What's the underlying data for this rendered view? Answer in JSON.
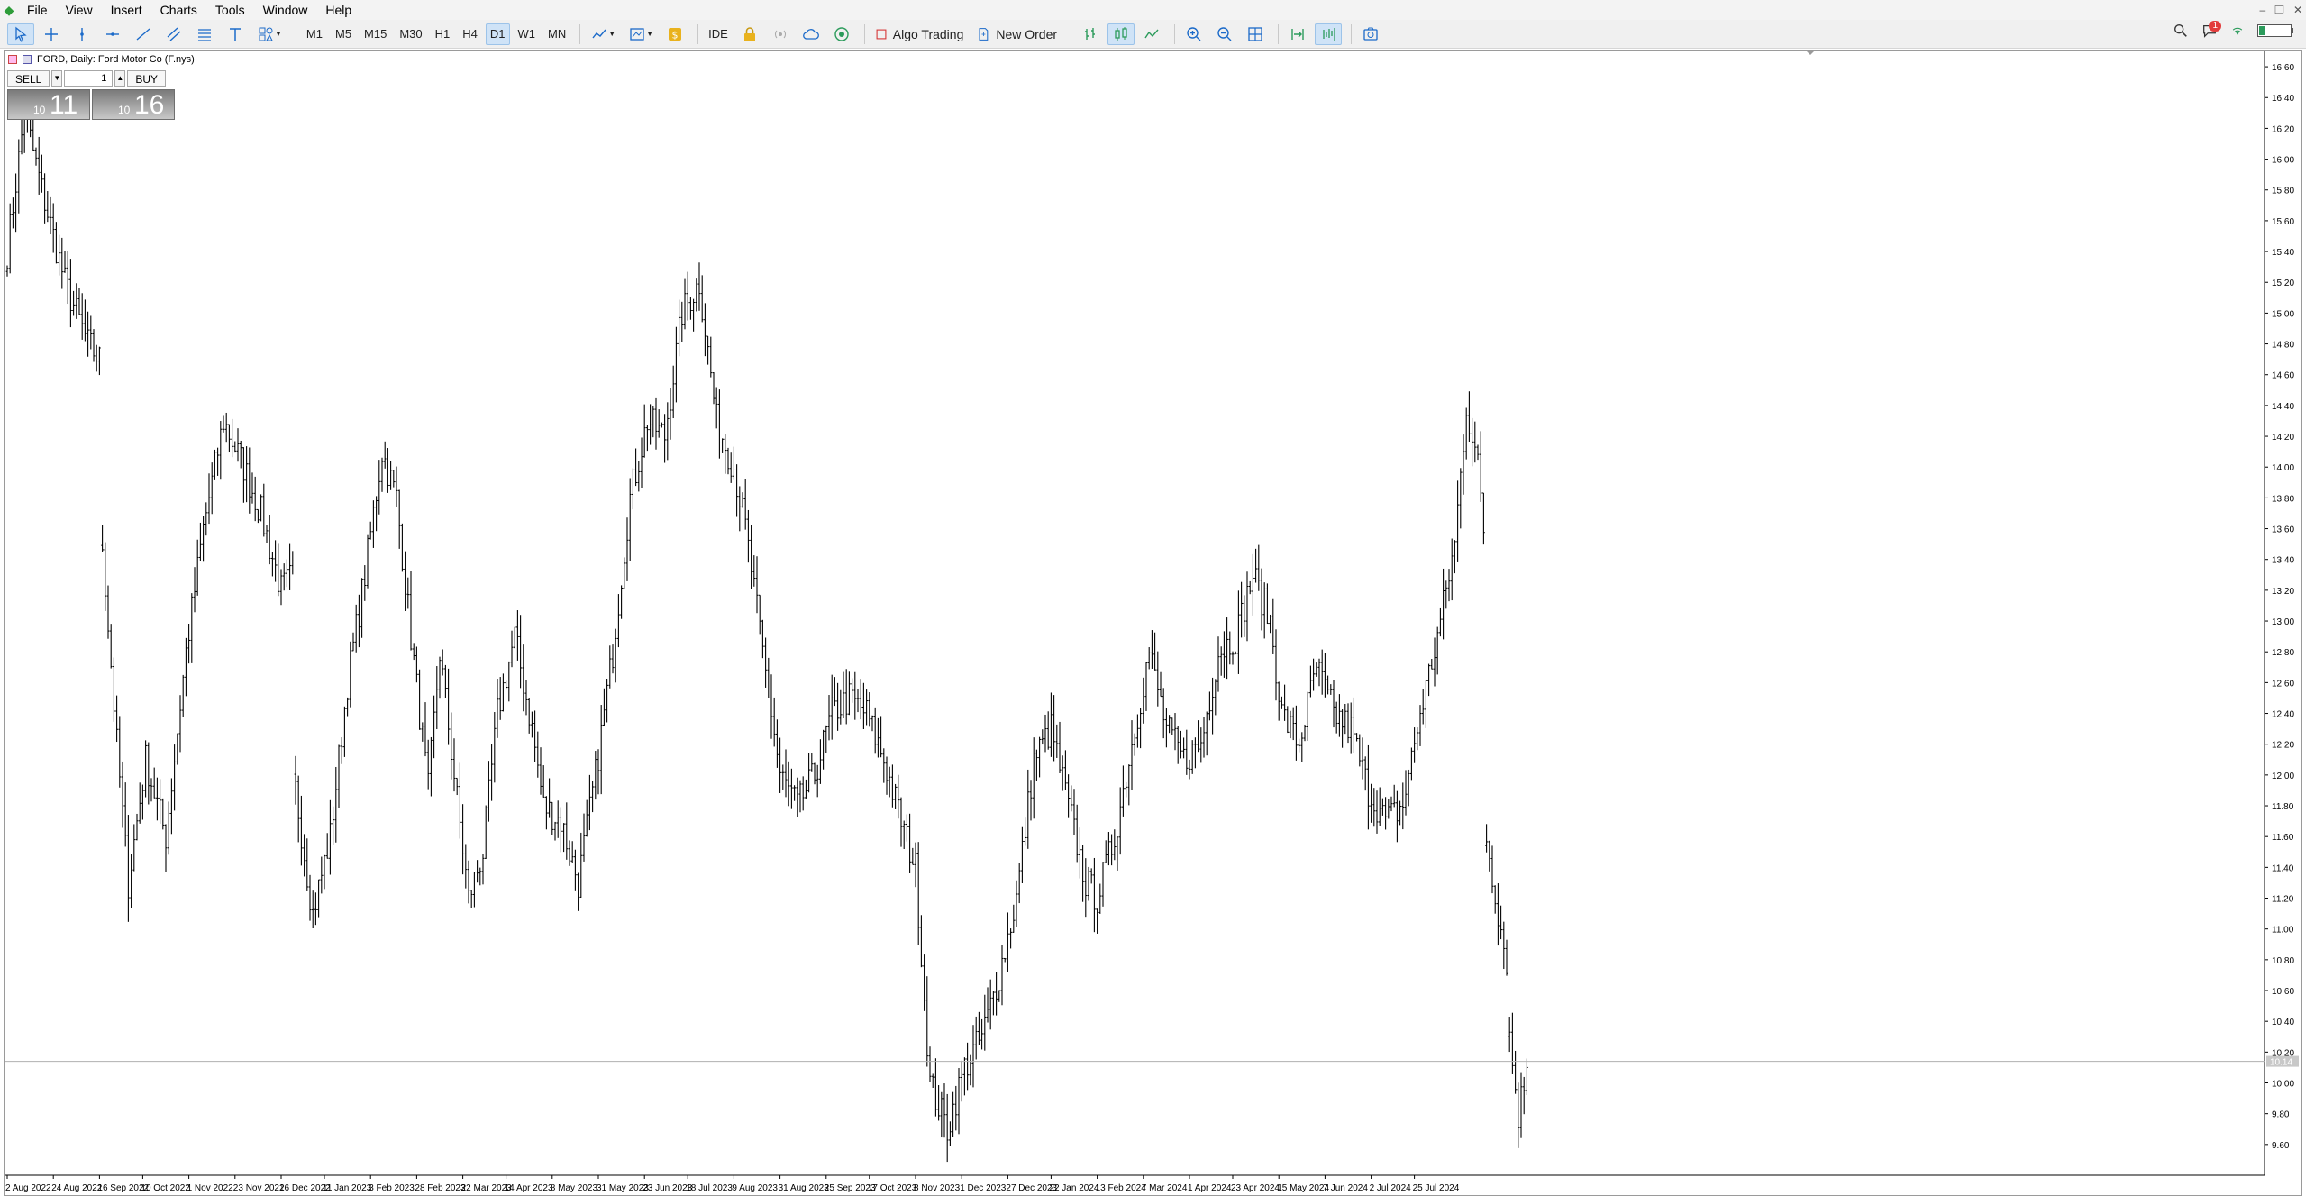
{
  "app": {
    "menu": [
      "File",
      "View",
      "Insert",
      "Charts",
      "Tools",
      "Window",
      "Help"
    ]
  },
  "toolbar": {
    "timeframes": [
      "M1",
      "M5",
      "M15",
      "M30",
      "H1",
      "H4",
      "D1",
      "W1",
      "MN"
    ],
    "active_timeframe": "D1",
    "ide_label": "IDE",
    "algo_label": "Algo Trading",
    "order_label": "New Order",
    "notification_count": "1",
    "icons": [
      "cursor-icon",
      "crosshair-icon",
      "vertical-line-icon",
      "horizontal-line-icon",
      "trend-line-icon",
      "channel-icon",
      "fibonacci-icon",
      "text-icon",
      "shapes-icon",
      "indicators-icon",
      "templates-icon",
      "dollar-icon",
      "lock-icon",
      "signal-icon",
      "cloud-icon",
      "vps-icon",
      "bar-chart-icon",
      "candle-chart-icon",
      "line-chart-icon",
      "zoom-in-icon",
      "zoom-out-icon",
      "grid-icon",
      "autoscroll-icon",
      "chart-shift-icon",
      "screenshot-icon",
      "search-icon",
      "chat-icon",
      "wifi-icon",
      "battery-icon"
    ]
  },
  "chart": {
    "title": "FORD, Daily:  Ford Motor Co (F.nys)",
    "trade": {
      "sell_label": "SELL",
      "buy_label": "BUY",
      "volume": "1",
      "sell_small": "10",
      "sell_big": "11",
      "buy_small": "10",
      "buy_big": "16"
    },
    "current_price_label": "10.14",
    "colors": {
      "bars": "#000000",
      "grid_line": "#c0c0c0",
      "price_line": "#b0b0b0"
    }
  },
  "chart_data": {
    "type": "bar",
    "symbol": "FORD",
    "timeframe": "Daily",
    "ylim": [
      9.4,
      16.7
    ],
    "y_ticks": [
      9.6,
      9.8,
      10.0,
      10.2,
      10.4,
      10.6,
      10.8,
      11.0,
      11.2,
      11.4,
      11.6,
      11.8,
      12.0,
      12.2,
      12.4,
      12.6,
      12.8,
      13.0,
      13.2,
      13.4,
      13.6,
      13.8,
      14.0,
      14.2,
      14.4,
      14.6,
      14.8,
      15.0,
      15.2,
      15.4,
      15.6,
      15.8,
      16.0,
      16.2,
      16.4,
      16.6
    ],
    "x_labels": [
      "2 Aug 2022",
      "24 Aug 2022",
      "16 Sep 2022",
      "10 Oct 2022",
      "1 Nov 2022",
      "23 Nov 2022",
      "16 Dec 2022",
      "11 Jan 2023",
      "3 Feb 2023",
      "28 Feb 2023",
      "22 Mar 2023",
      "14 Apr 2023",
      "8 May 2023",
      "31 May 2023",
      "23 Jun 2023",
      "18 Jul 2023",
      "9 Aug 2023",
      "31 Aug 2023",
      "25 Sep 2023",
      "17 Oct 2023",
      "8 Nov 2023",
      "1 Dec 2023",
      "27 Dec 2023",
      "22 Jan 2024",
      "13 Feb 2024",
      "7 Mar 2024",
      "1 Apr 2024",
      "23 Apr 2024",
      "15 May 2024",
      "7 Jun 2024",
      "2 Jul 2024",
      "25 Jul 2024"
    ],
    "anchors": [
      [
        0,
        15.4
      ],
      [
        6,
        16.3
      ],
      [
        12,
        15.8
      ],
      [
        20,
        15.2
      ],
      [
        28,
        14.8
      ],
      [
        32,
        14.7
      ],
      [
        33,
        13.5
      ],
      [
        38,
        12.2
      ],
      [
        42,
        11.3
      ],
      [
        48,
        12.1
      ],
      [
        55,
        11.6
      ],
      [
        62,
        12.8
      ],
      [
        68,
        13.6
      ],
      [
        75,
        14.3
      ],
      [
        82,
        14.0
      ],
      [
        88,
        13.7
      ],
      [
        95,
        13.2
      ],
      [
        99,
        13.3
      ],
      [
        100,
        11.9
      ],
      [
        106,
        11.1
      ],
      [
        112,
        11.6
      ],
      [
        118,
        12.6
      ],
      [
        124,
        13.3
      ],
      [
        130,
        14.1
      ],
      [
        135,
        13.8
      ],
      [
        140,
        12.9
      ],
      [
        146,
        11.9
      ],
      [
        150,
        12.8
      ],
      [
        155,
        12.0
      ],
      [
        160,
        11.2
      ],
      [
        165,
        11.5
      ],
      [
        170,
        12.4
      ],
      [
        176,
        12.9
      ],
      [
        182,
        12.3
      ],
      [
        186,
        11.8
      ],
      [
        192,
        11.7
      ],
      [
        198,
        11.3
      ],
      [
        204,
        12.0
      ],
      [
        210,
        12.8
      ],
      [
        216,
        13.8
      ],
      [
        222,
        14.3
      ],
      [
        228,
        14.2
      ],
      [
        234,
        15.0
      ],
      [
        240,
        15.2
      ],
      [
        246,
        14.3
      ],
      [
        252,
        14.0
      ],
      [
        256,
        13.6
      ],
      [
        262,
        12.8
      ],
      [
        268,
        12.0
      ],
      [
        274,
        11.8
      ],
      [
        280,
        12.0
      ],
      [
        286,
        12.4
      ],
      [
        292,
        12.5
      ],
      [
        298,
        12.4
      ],
      [
        304,
        12.1
      ],
      [
        310,
        11.7
      ],
      [
        315,
        11.4
      ],
      [
        320,
        10.0
      ],
      [
        326,
        9.7
      ],
      [
        332,
        10.1
      ],
      [
        338,
        10.3
      ],
      [
        344,
        10.7
      ],
      [
        350,
        11.2
      ],
      [
        356,
        12.1
      ],
      [
        362,
        12.3
      ],
      [
        368,
        11.8
      ],
      [
        374,
        11.3
      ],
      [
        378,
        11.2
      ],
      [
        384,
        11.6
      ],
      [
        390,
        12.2
      ],
      [
        396,
        12.8
      ],
      [
        402,
        12.3
      ],
      [
        408,
        12.1
      ],
      [
        414,
        12.2
      ],
      [
        420,
        12.8
      ],
      [
        426,
        12.9
      ],
      [
        432,
        13.3
      ],
      [
        438,
        13.0
      ],
      [
        442,
        12.4
      ],
      [
        448,
        12.2
      ],
      [
        454,
        12.7
      ],
      [
        460,
        12.4
      ],
      [
        466,
        12.3
      ],
      [
        472,
        11.9
      ],
      [
        478,
        11.7
      ],
      [
        484,
        11.8
      ],
      [
        490,
        12.4
      ],
      [
        496,
        12.9
      ],
      [
        502,
        13.5
      ],
      [
        506,
        14.4
      ],
      [
        510,
        14.0
      ],
      [
        512,
        13.6
      ],
      [
        513,
        11.6
      ],
      [
        518,
        11.0
      ],
      [
        520,
        10.8
      ],
      [
        521,
        10.3
      ],
      [
        524,
        9.8
      ],
      [
        527,
        10.1
      ]
    ]
  }
}
